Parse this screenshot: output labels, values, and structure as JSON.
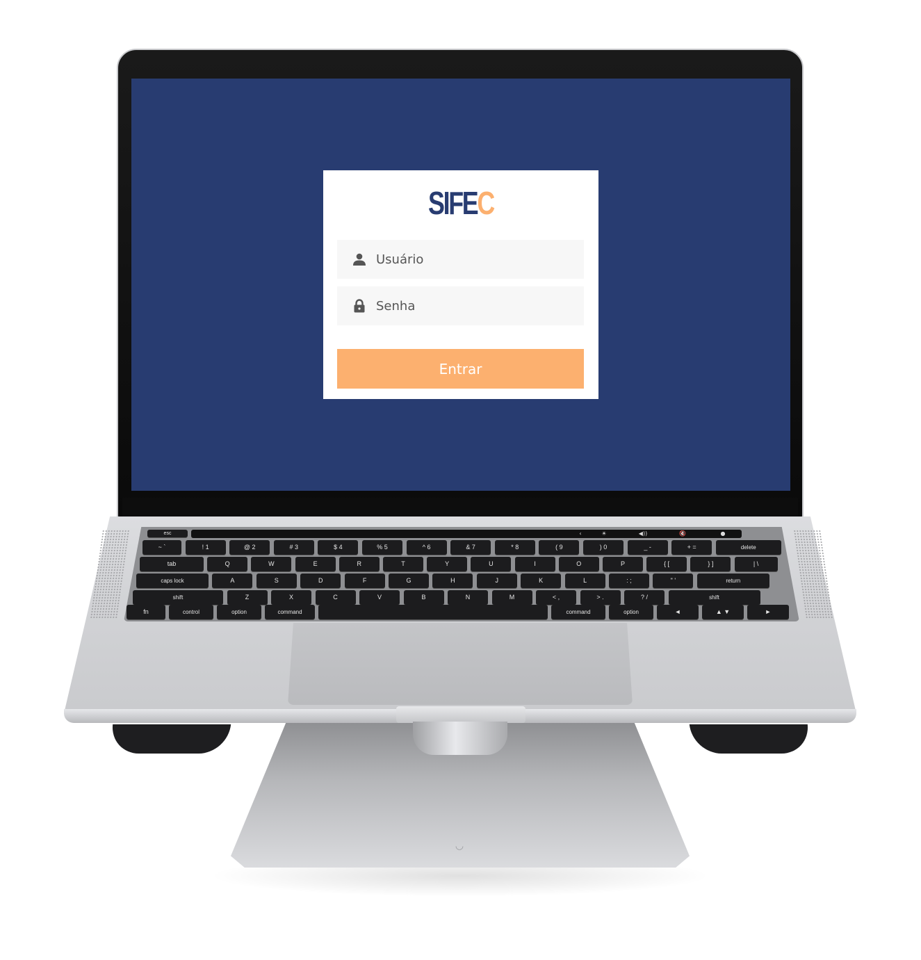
{
  "login": {
    "logo": {
      "main": "SIFE",
      "accent": "C"
    },
    "username": {
      "placeholder": "Usuário",
      "value": ""
    },
    "password": {
      "placeholder": "Senha",
      "value": ""
    },
    "submit_label": "Entrar",
    "colors": {
      "background": "#283c71",
      "card": "#ffffff",
      "field": "#f7f7f7",
      "accent": "#fcb06f",
      "brand": "#283c71"
    }
  },
  "icons": {
    "username": "user-icon",
    "password": "lock-icon"
  },
  "keyboard": {
    "touchbar": [
      "‹",
      "☀",
      "◀))",
      "🔇",
      "●"
    ],
    "rows": [
      [
        "esc"
      ],
      [
        "~ `",
        "! 1",
        "@ 2",
        "# 3",
        "$ 4",
        "% 5",
        "^ 6",
        "& 7",
        "* 8",
        "( 9",
        ") 0",
        "_ -",
        "+ =",
        "delete"
      ],
      [
        "tab",
        "Q",
        "W",
        "E",
        "R",
        "T",
        "Y",
        "U",
        "I",
        "O",
        "P",
        "{ [",
        "} ]",
        "| \\"
      ],
      [
        "caps lock",
        "A",
        "S",
        "D",
        "F",
        "G",
        "H",
        "J",
        "K",
        "L",
        ": ;",
        "\" '",
        "return"
      ],
      [
        "shift",
        "Z",
        "X",
        "C",
        "V",
        "B",
        "N",
        "M",
        "< ,",
        "> .",
        "? /",
        "shift"
      ],
      [
        "fn",
        "control",
        "option",
        "command",
        "",
        "command",
        "option",
        "◄",
        "▲ ▼",
        "►"
      ]
    ]
  }
}
